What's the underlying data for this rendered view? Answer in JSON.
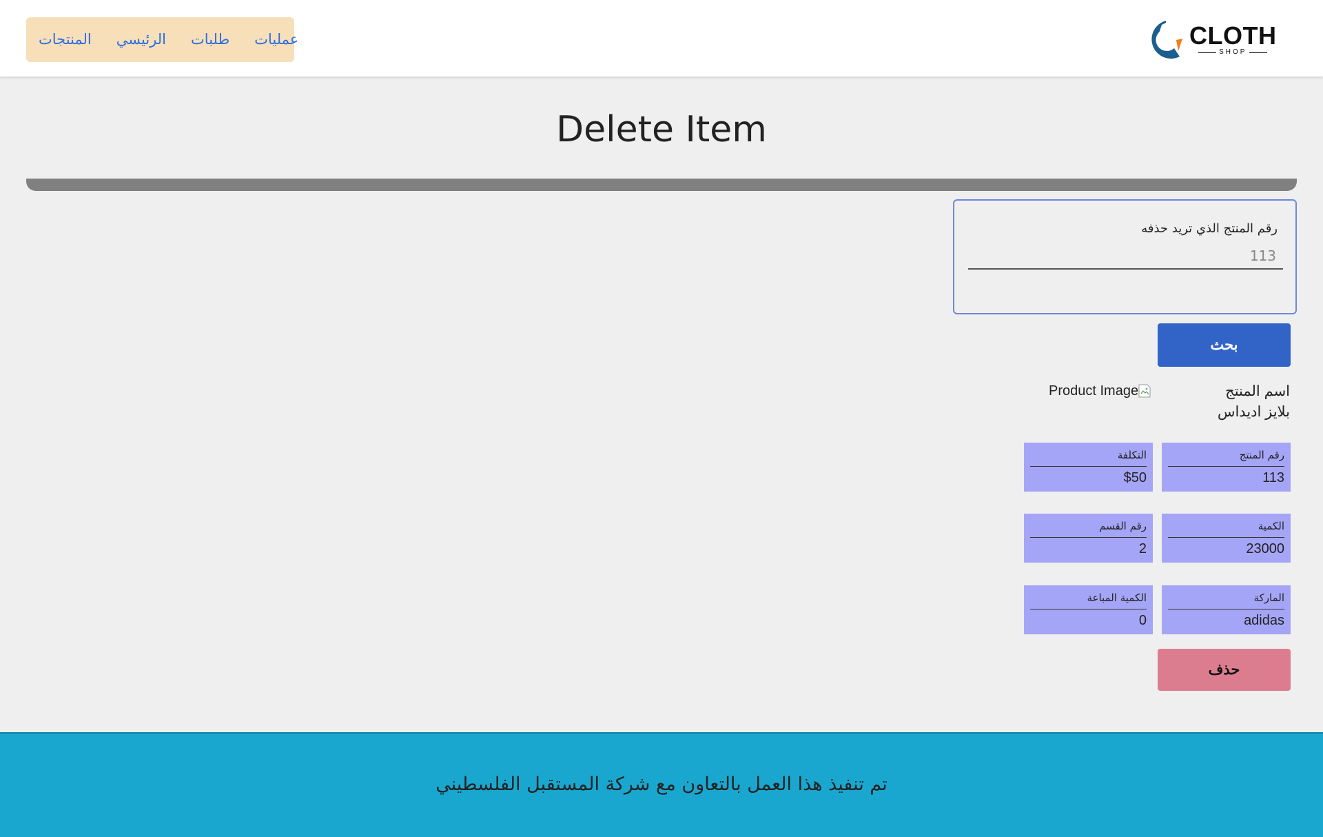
{
  "nav": {
    "items": [
      {
        "label": "عمليات"
      },
      {
        "label": "طلبات"
      },
      {
        "label": "الرئيسي"
      },
      {
        "label": "المنتجات"
      }
    ]
  },
  "logo": {
    "word": "CLOTH",
    "sub": "SHOP",
    "colors": {
      "primary": "#1a5f8f",
      "accent": "#ef7f1a"
    }
  },
  "page": {
    "title": "Delete Item"
  },
  "search": {
    "label": "رقم المنتج الذي تريد حذفه",
    "value": "113",
    "button_label": "بحث"
  },
  "product": {
    "name_label": "اسم المنتج",
    "name_value": "بلايز اديداس",
    "image_alt": "Product Image",
    "fields": {
      "product_number": {
        "label": "رقم المنتج",
        "value": "113"
      },
      "cost": {
        "label": "التكلفة",
        "value": "$50"
      },
      "quantity": {
        "label": "الكمية",
        "value": "23000"
      },
      "category_number": {
        "label": "رقم القسم",
        "value": "2"
      },
      "brand": {
        "label": "الماركة",
        "value": "adidas"
      },
      "sold_quantity": {
        "label": "الكمية المباعة",
        "value": "0"
      }
    },
    "delete_label": "حذف"
  },
  "footer": {
    "text": "تم تنفيذ هذا العمل بالتعاون مع شركة المستقبل الفلسطيني"
  },
  "colors": {
    "header_bg": "#ffffff",
    "nav_bg": "#f6dfb9",
    "link": "#2f6de0",
    "search_button": "#3264c8",
    "field_bg": "#a5a5f7",
    "delete_button": "#dc7d8f",
    "footer_bg": "#1aa7cf"
  }
}
